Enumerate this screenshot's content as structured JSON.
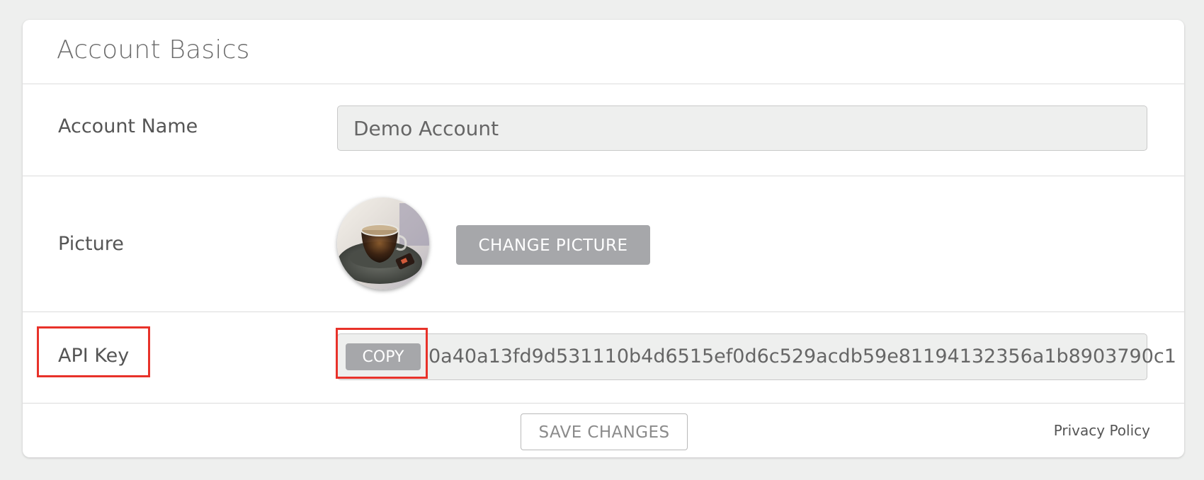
{
  "card": {
    "title": "Account Basics"
  },
  "account_name": {
    "label": "Account Name",
    "value": "Demo Account"
  },
  "picture": {
    "label": "Picture",
    "change_button": "CHANGE PICTURE",
    "avatar_icon": "coffee-cup-photo"
  },
  "api_key": {
    "label": "API Key",
    "copy_button": "COPY",
    "value": "0a40a13fd9d531110b4d6515ef0d6c529acdb59e81194132356a1b8903790c1"
  },
  "footer": {
    "save_button": "SAVE CHANGES",
    "privacy_link": "Privacy Policy"
  },
  "colors": {
    "background": "#eeefee",
    "button_gray": "#a6a7aa",
    "highlight_red": "#e8322a"
  }
}
